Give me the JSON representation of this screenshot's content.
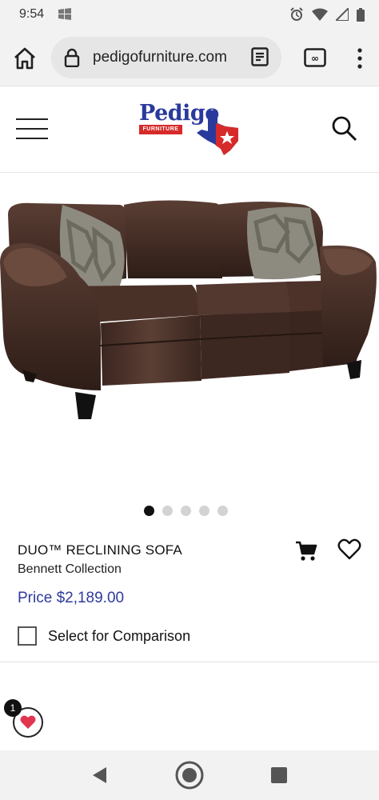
{
  "status_bar": {
    "time": "9:54"
  },
  "browser": {
    "url": "pedigofurniture.com"
  },
  "site": {
    "logo_text": "Pedigo",
    "logo_sub": "FURNITURE"
  },
  "gallery": {
    "total_images": 5,
    "active_index": 0
  },
  "product": {
    "name": "DUO™ RECLINING SOFA",
    "collection": "Bennett Collection",
    "price": "Price $2,189.00",
    "compare_label": "Select for Comparison"
  },
  "wishlist": {
    "count": "1"
  },
  "colors": {
    "price": "#2f3a9c",
    "logo_blue": "#2a3a9c",
    "logo_red": "#d72a2a",
    "heart": "#e0344f"
  },
  "icons": [
    "home-icon",
    "lock-icon",
    "reader-mode-icon",
    "tab-switcher-icon",
    "more-menu-icon",
    "hamburger-icon",
    "search-icon",
    "cart-icon",
    "heart-outline-icon",
    "heart-icon"
  ]
}
